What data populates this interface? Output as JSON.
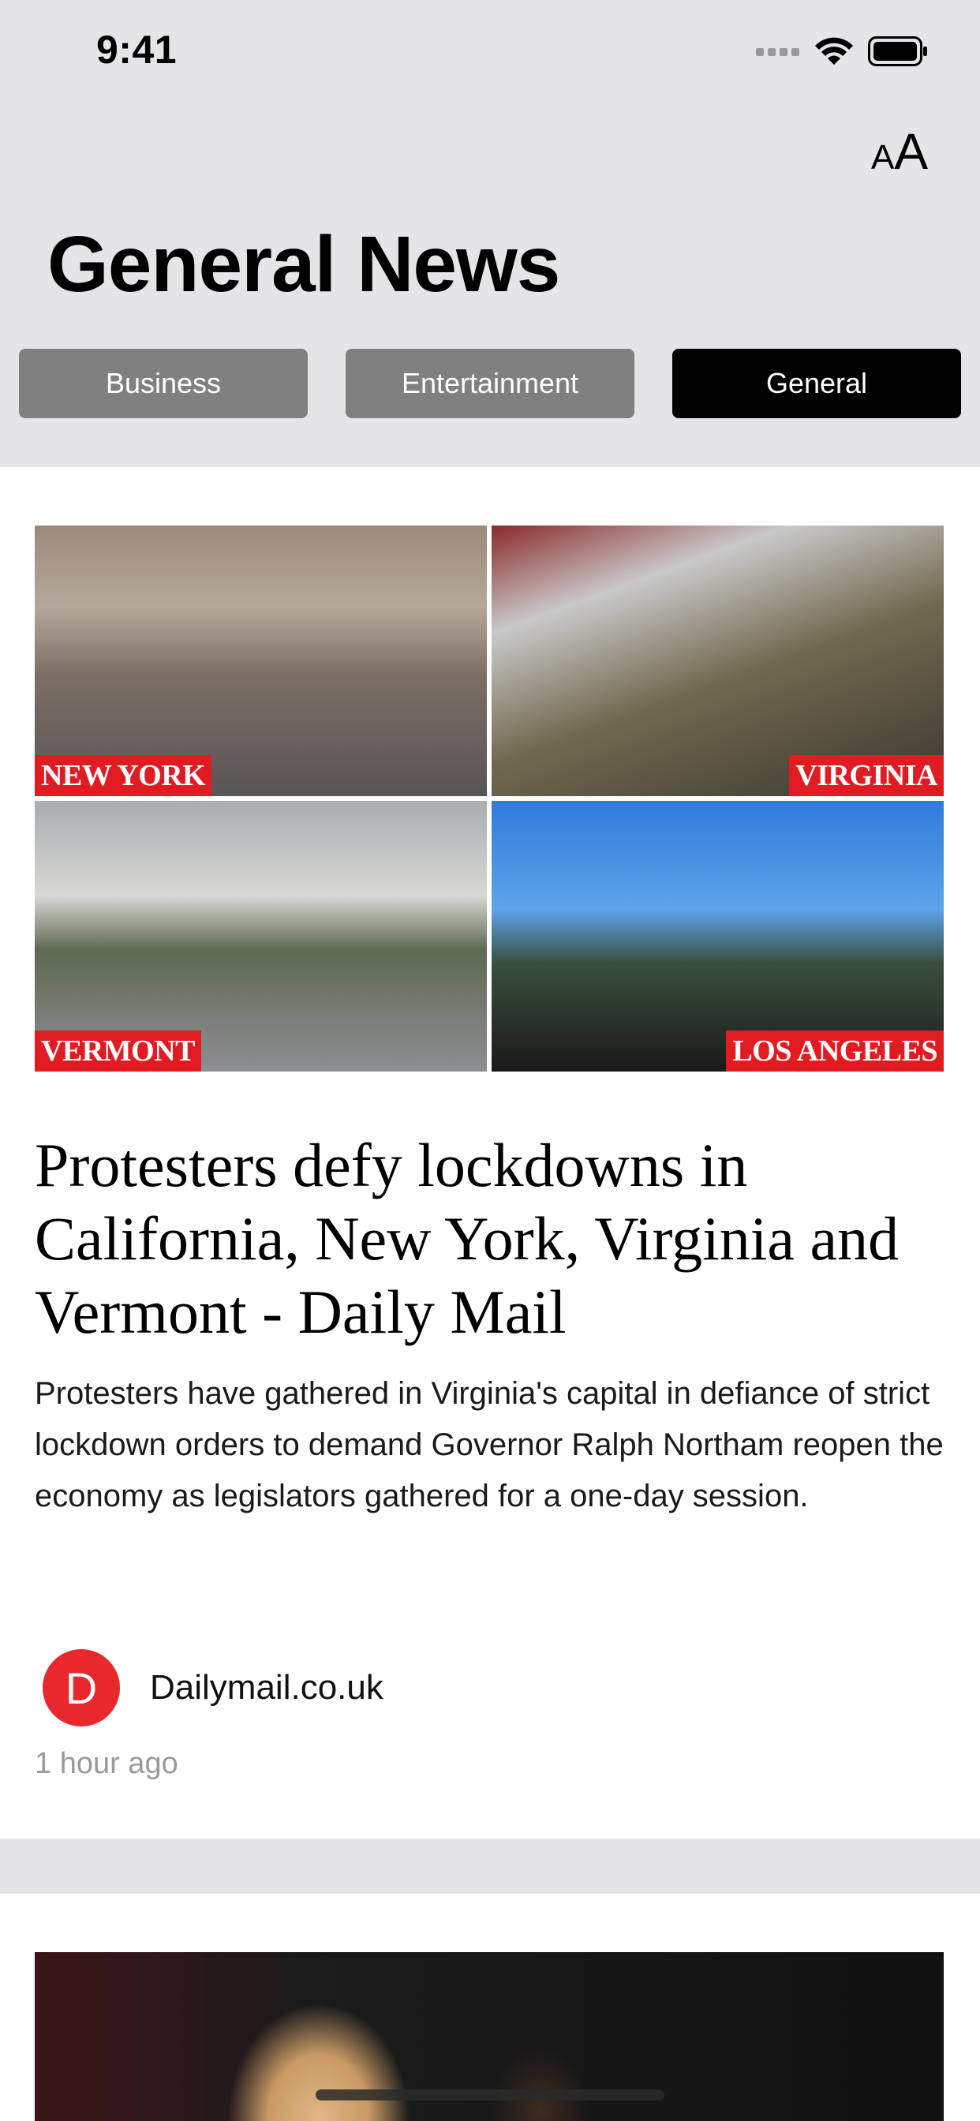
{
  "status_bar": {
    "time": "9:41"
  },
  "header": {
    "text_size_label_small": "A",
    "text_size_label_large": "A",
    "title": "General News"
  },
  "tabs": [
    {
      "label": "Business",
      "active": false
    },
    {
      "label": "Entertainment",
      "active": false
    },
    {
      "label": "General",
      "active": true
    }
  ],
  "articles": [
    {
      "image_captions": [
        "NEW YORK",
        "VIRGINIA",
        "VERMONT",
        "LOS ANGELES"
      ],
      "headline": "Protesters defy lockdowns in California, New York, Virginia and Vermont - Daily Mail",
      "description": "Protesters have gathered in Virginia's capital in defiance of strict lockdown orders to demand Governor Ralph Northam reopen the economy as legislators gathered for a one-day session.",
      "source_initial": "D",
      "source": "Dailymail.co.uk",
      "time_ago": "1 hour ago"
    }
  ],
  "colors": {
    "accent_active_tab": "#000000",
    "inactive_tab": "#808080",
    "avatar": "#e8282d",
    "caption_red": "#e11b22"
  }
}
